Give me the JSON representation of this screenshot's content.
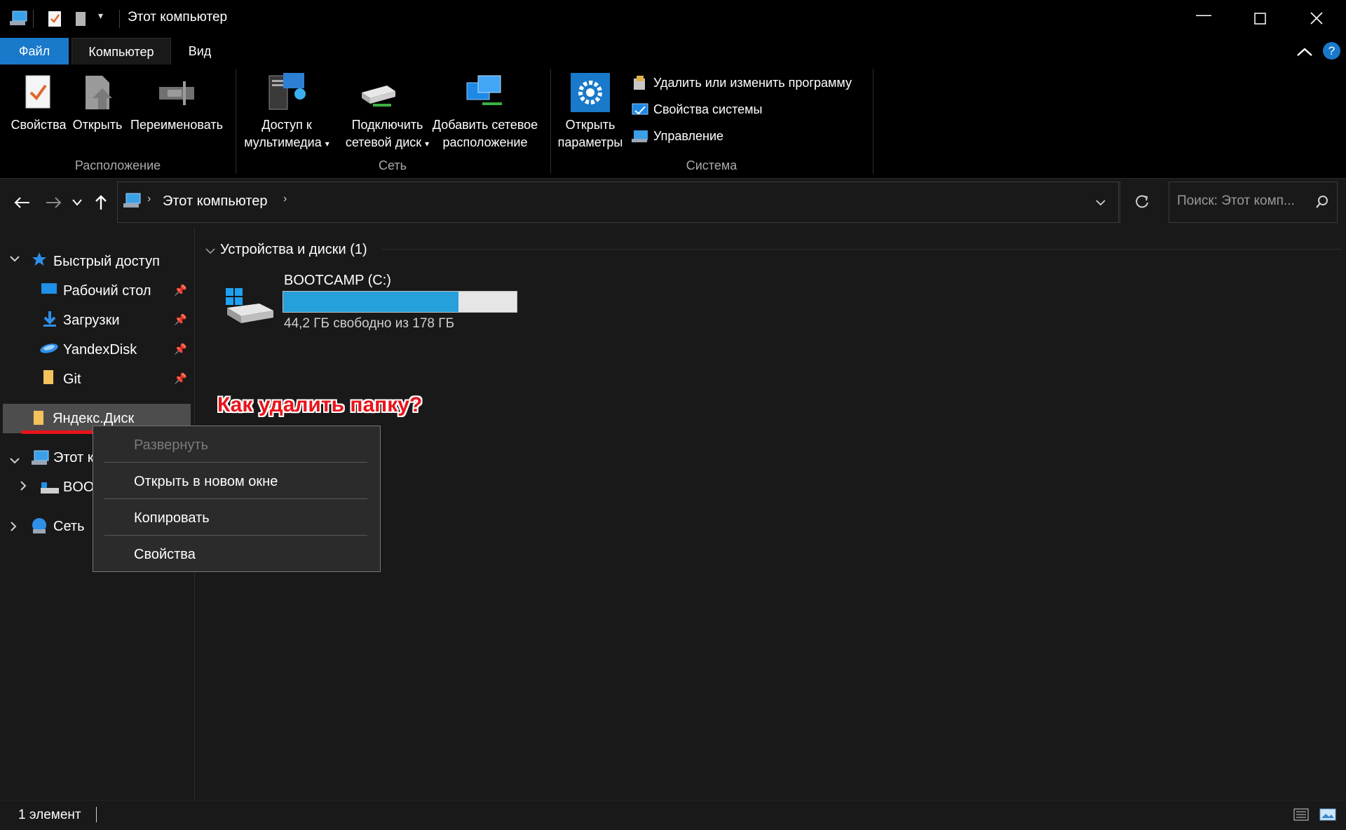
{
  "window": {
    "title": "Этот компьютер",
    "qat_icons": [
      "this-pc-icon",
      "properties-check-icon",
      "new-folder-icon",
      "dropdown-icon"
    ],
    "controls": [
      "minimize-icon",
      "maximize-icon",
      "close-icon"
    ]
  },
  "tabs": [
    {
      "label": "Файл",
      "active_color": "#1979ca"
    },
    {
      "label": "Компьютер"
    },
    {
      "label": "Вид"
    }
  ],
  "help_label": "?",
  "ribbon": {
    "location": {
      "group_label": "Расположение",
      "properties": "Свойства",
      "open": "Открыть",
      "rename": "Переименовать"
    },
    "network": {
      "group_label": "Сеть",
      "media_access_line1": "Доступ к",
      "media_access_line2": "мультимедиа",
      "map_drive_line1": "Подключить",
      "map_drive_line2": "сетевой диск",
      "add_location_line1": "Добавить сетевое",
      "add_location_line2": "расположение"
    },
    "system": {
      "group_label": "Система",
      "open_settings_line1": "Открыть",
      "open_settings_line2": "параметры",
      "uninstall": "Удалить или изменить программу",
      "system_properties": "Свойства системы",
      "manage": "Управление"
    }
  },
  "address": {
    "breadcrumb": "Этот компьютер",
    "search_placeholder": "Поиск: Этот комп..."
  },
  "sidebar": {
    "quick_access": "Быстрый доступ",
    "items": [
      {
        "label": "Рабочий стол"
      },
      {
        "label": "Загрузки"
      },
      {
        "label": "YandexDisk"
      },
      {
        "label": "Git"
      }
    ],
    "selected": "Яндекс.Диск",
    "this_pc": "Этот к",
    "drive": "BOO",
    "network": "Сеть"
  },
  "content": {
    "group_header": "Устройства и диски (1)",
    "drive_name": "BOOTCAMP (C:)",
    "drive_free_text": "44,2 ГБ свободно из 178 ГБ",
    "used_fraction": 0.75
  },
  "annotation": "Как удалить папку?",
  "context_menu": {
    "expand": "Развернуть",
    "open_new_window": "Открыть в новом окне",
    "copy": "Копировать",
    "properties": "Свойства"
  },
  "status": {
    "count": "1 элемент"
  }
}
